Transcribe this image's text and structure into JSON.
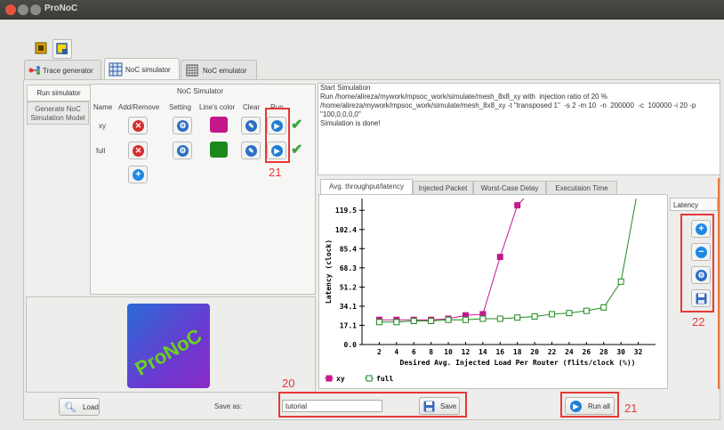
{
  "app": {
    "title": "ProNoC"
  },
  "colors": {
    "accent_red": "#e53935",
    "xy": "#c2188a",
    "full": "#1a8a1a"
  },
  "main_tabs": [
    {
      "label": "Trace generator"
    },
    {
      "label": "NoC simulator"
    },
    {
      "label": "NoC emulator"
    }
  ],
  "side_tabs": [
    {
      "label": "Run simulator"
    },
    {
      "label": "Generate NoC Simulation Model"
    }
  ],
  "simulator": {
    "title": "NoC Simulator",
    "headers": {
      "name": "Name",
      "add_remove": "Add/Remove",
      "setting": "Setting",
      "color": "Line's color",
      "clear": "Clear",
      "run": "Run"
    },
    "rows": [
      {
        "name": "xy",
        "color": "#c2188a"
      },
      {
        "name": "full",
        "color": "#1a8a1a"
      }
    ]
  },
  "logo": {
    "text": "ProNoC"
  },
  "log": {
    "lines": [
      "Start Simulation",
      "Run /home/alireza/mywork/mpsoc_work/simulate/mesh_8x8_xy with  injection ratio of 20 %",
      "/home/alireza/mywork/mpsoc_work/simulate/mesh_8x8_xy -t \"transposed 1\"  -s 2 -m 10  -n  200000  -c  100000 -i 20 -p \"100,0,0,0,0\"",
      "Simulation is done!"
    ]
  },
  "chart_tabs": [
    {
      "label": "Avg. throughput/latency"
    },
    {
      "label": "Injected Packet"
    },
    {
      "label": "Worst-Case Delay"
    },
    {
      "label": "Executaion Time"
    }
  ],
  "chart_side": {
    "dropdown": "Latency"
  },
  "chart_data": {
    "type": "line",
    "xlabel": "Desired Avg. Injected Load Per Router (flits/clock (%))",
    "ylabel": "Latency (clock)",
    "xticks": [
      2,
      4,
      6,
      8,
      10,
      12,
      14,
      16,
      18,
      20,
      22,
      24,
      26,
      28,
      30,
      32
    ],
    "yticks": [
      0.0,
      17.1,
      34.1,
      51.2,
      68.3,
      85.4,
      102.4,
      119.5
    ],
    "xlim": [
      0,
      34
    ],
    "ylim": [
      0,
      130
    ],
    "legend_placement": "bottom-left",
    "series": [
      {
        "name": "xy",
        "marker": "filled-square",
        "x": [
          2,
          4,
          6,
          8,
          10,
          12,
          14,
          16,
          18,
          20
        ],
        "y": [
          22,
          22,
          22,
          22,
          23,
          26,
          27,
          78,
          124,
          140
        ]
      },
      {
        "name": "full",
        "marker": "open-square",
        "x": [
          2,
          4,
          6,
          8,
          10,
          12,
          14,
          16,
          18,
          20,
          22,
          24,
          26,
          28,
          30,
          32
        ],
        "y": [
          20,
          20,
          21,
          21,
          22,
          22,
          23,
          23,
          24,
          25,
          27,
          28,
          30,
          33,
          56,
          140
        ]
      }
    ]
  },
  "bottom": {
    "load_label": "Load",
    "save_as_label": "Save as:",
    "save_value": "tutorial",
    "save_label": "Save",
    "run_all_label": "Run all"
  },
  "annotations": {
    "n21_run": "21",
    "n20": "20",
    "n21_runall": "21",
    "n22": "22"
  }
}
